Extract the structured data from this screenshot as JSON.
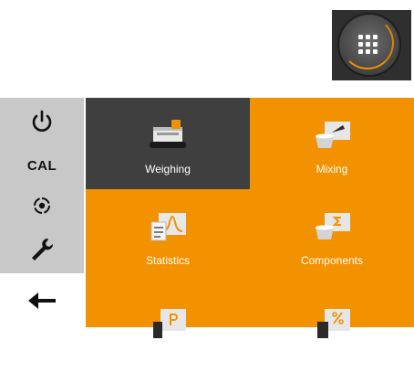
{
  "home_button": {
    "icon": "grid-icon",
    "accent_color": "#f39200"
  },
  "sidebar": {
    "items": [
      {
        "name": "power",
        "icon": "power-icon"
      },
      {
        "name": "cal",
        "label": "CAL"
      },
      {
        "name": "target",
        "icon": "target-icon"
      },
      {
        "name": "settings",
        "icon": "wrench-icon"
      },
      {
        "name": "back",
        "icon": "arrow-left-icon"
      }
    ]
  },
  "main": {
    "accent_color": "#f39200",
    "selected_tile_color": "#3f3f3f",
    "tiles": [
      {
        "label": "Weighing",
        "icon": "scale-icon",
        "selected": true
      },
      {
        "label": "Mixing",
        "icon": "beaker-drop-icon",
        "selected": false
      },
      {
        "label": "Statistics",
        "icon": "statistics-icon",
        "selected": false
      },
      {
        "label": "Components",
        "icon": "sigma-icon",
        "selected": false
      },
      {
        "label": "",
        "icon": "density-icon",
        "selected": false
      },
      {
        "label": "",
        "icon": "percent-icon",
        "selected": false
      }
    ]
  }
}
